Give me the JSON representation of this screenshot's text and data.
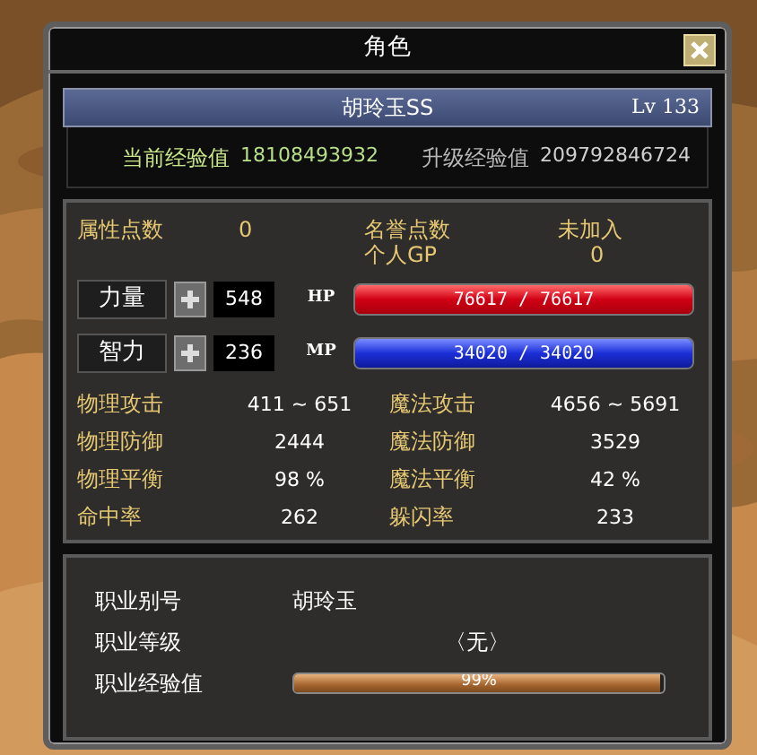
{
  "window": {
    "title": "角色"
  },
  "character": {
    "name": "胡玲玉SS",
    "level": "Lv 133"
  },
  "experience": [
    {
      "kind": "current",
      "label": "当前经验值",
      "value": "18108493932"
    },
    {
      "kind": "next",
      "label": "升级经验值",
      "value": "209792846724"
    }
  ],
  "points": {
    "attribute_label": "属性点数",
    "attribute_value": "0",
    "honor_label": "名誉点数",
    "honor_value": "未加入",
    "gp_label": "个人GP",
    "gp_value": "0"
  },
  "attributes": [
    {
      "kind": "hp",
      "label": "力量",
      "value": "548",
      "bar_label": "HP",
      "reading": "76617 / 76617",
      "level": 1
    },
    {
      "kind": "mp",
      "label": "智力",
      "value": "236",
      "bar_label": "MP",
      "reading": "34020 / 34020",
      "level": 1
    }
  ],
  "stats": [
    {
      "label": "物理攻击",
      "value": "411 ~ 651"
    },
    {
      "label": "魔法攻击",
      "value": "4656 ~ 5691"
    },
    {
      "label": "物理防御",
      "value": "2444"
    },
    {
      "label": "魔法防御",
      "value": "3529"
    },
    {
      "label": "物理平衡",
      "value": "98 %"
    },
    {
      "label": "魔法平衡",
      "value": "42 %"
    },
    {
      "label": "命中率",
      "value": "262"
    },
    {
      "label": "躲闪率",
      "value": "233"
    }
  ],
  "job": {
    "alias_label": "职业别号",
    "alias": "胡玲玉",
    "grade_label": "职业等级",
    "grade": "〈无〉",
    "exp_label": "职业经验值",
    "exp_reading": "99%",
    "level": 0.99
  }
}
